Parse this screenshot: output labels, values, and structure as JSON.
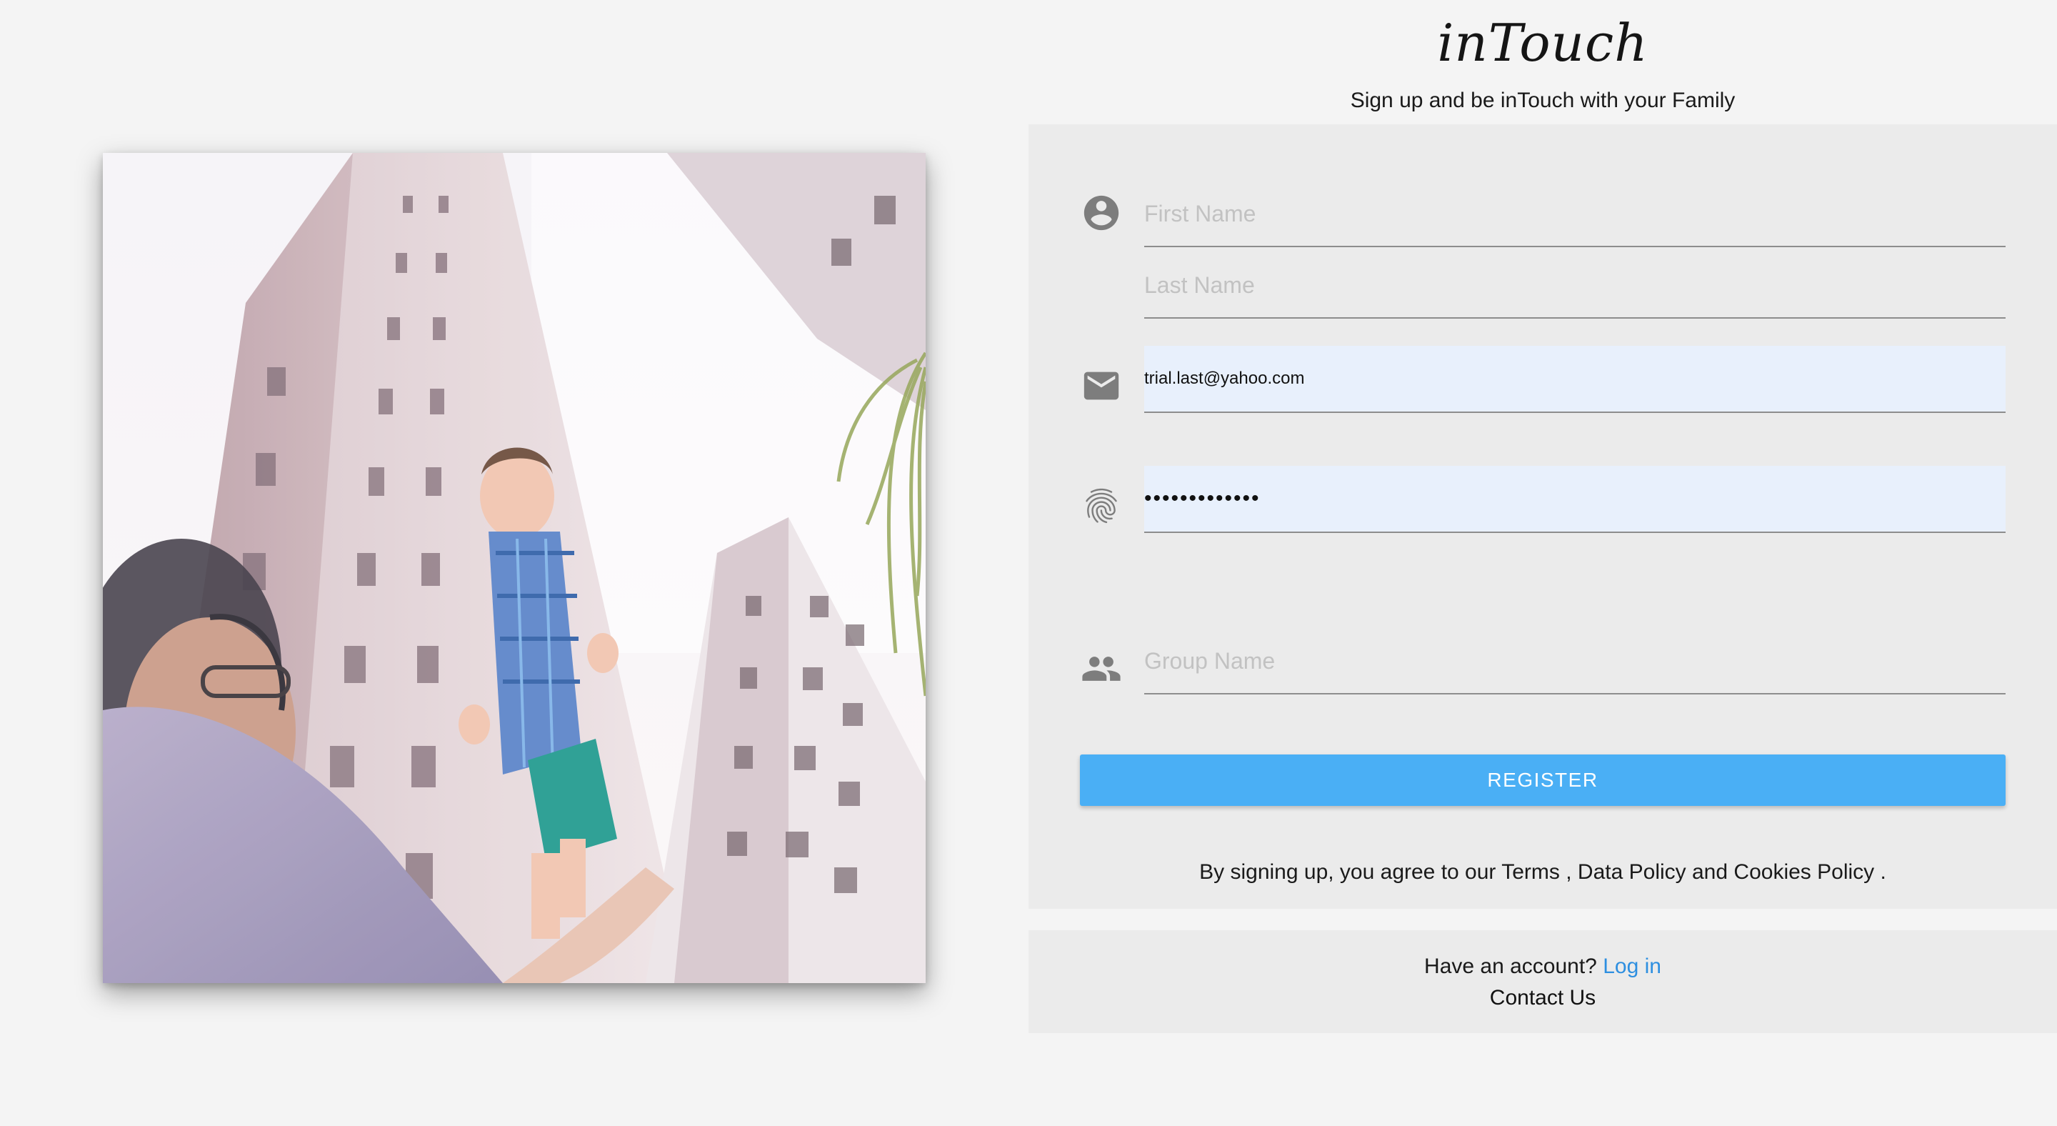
{
  "brand": {
    "logo_text": "inTouch",
    "tagline": "Sign up and be inTouch with your Family"
  },
  "hero": {
    "icon": "photo-father-lifting-child"
  },
  "form": {
    "fields": [
      {
        "id": "first_name",
        "icon": "account-circle-icon",
        "placeholder": "First Name",
        "value": ""
      },
      {
        "id": "last_name",
        "icon": "",
        "placeholder": "Last Name",
        "value": ""
      },
      {
        "id": "email",
        "icon": "mail-icon",
        "placeholder": "",
        "value": "trial.last@yahoo.com"
      },
      {
        "id": "password",
        "icon": "fingerprint-icon",
        "placeholder": "",
        "value": "•••••••••••••"
      },
      {
        "id": "group_name",
        "icon": "group-icon",
        "placeholder": "Group Name",
        "value": ""
      }
    ],
    "register_label": "REGISTER",
    "terms": {
      "prefix": "By signing up, you agree to our",
      "terms_link": "Terms",
      "separator": ",",
      "data_policy_link": "Data Policy",
      "and": "and",
      "cookies_link": "Cookies Policy",
      "suffix": "."
    }
  },
  "footer": {
    "have_account": "Have an account?",
    "login_link": "Log in",
    "contact_link": "Contact Us"
  },
  "colors": {
    "page_background": "#f4f4f4",
    "card_background": "#ebebeb",
    "primary_button": "#4aaff5",
    "link": "#2e8fe0",
    "autofill_background": "#e8f0fc",
    "icon_gray": "#7d7d7d"
  }
}
